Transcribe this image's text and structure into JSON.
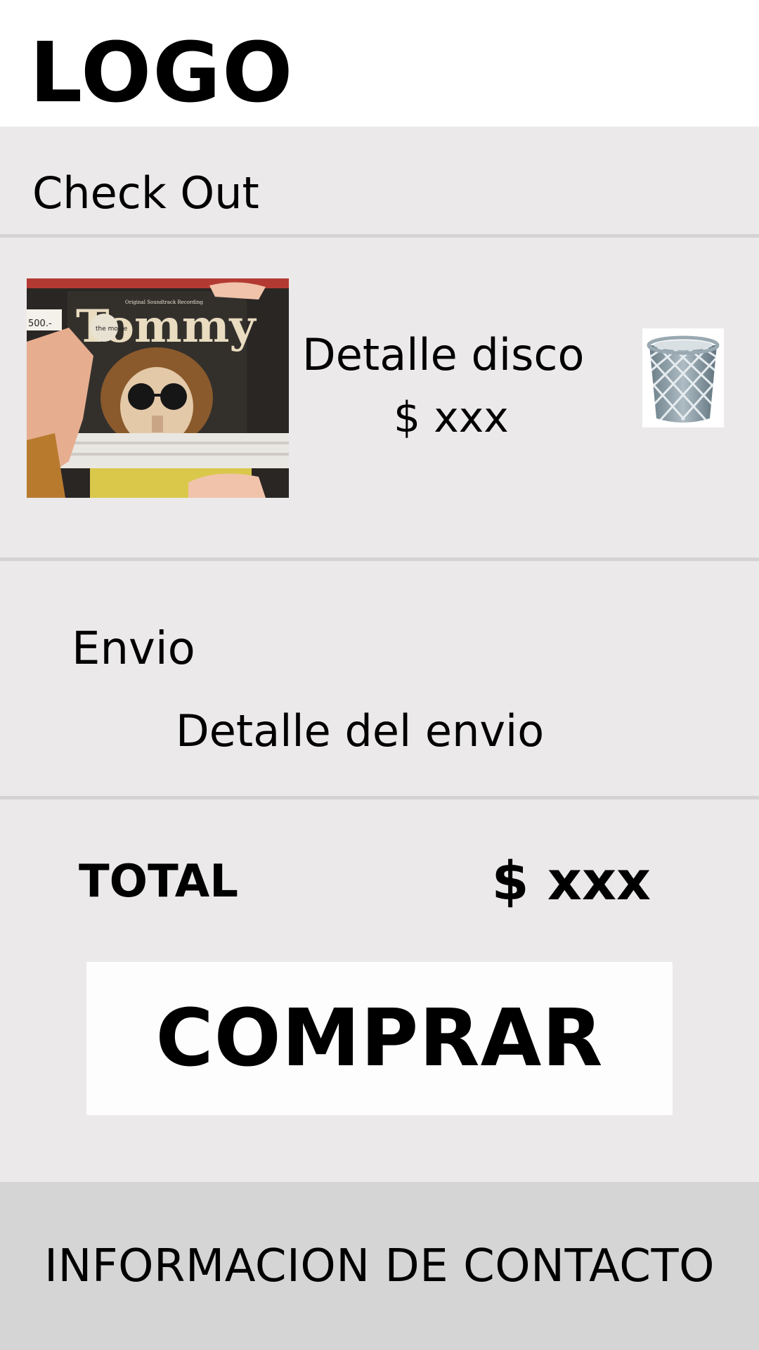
{
  "header": {
    "logo_text": "LOGO"
  },
  "checkout": {
    "title": "Check Out"
  },
  "cart_item": {
    "name": "Detalle disco",
    "price": "$ xxx",
    "album_title": "Tommy",
    "album_subtitle": "Original Soundtrack Recording",
    "album_badge": "the movie",
    "sticker_price": "500.-",
    "delete_icon": "trash-icon"
  },
  "shipping": {
    "label": "Envio",
    "detail": "Detalle del envio"
  },
  "total": {
    "label": "TOTAL",
    "value": "$ xxx"
  },
  "buy_button": {
    "label": "COMPRAR"
  },
  "footer": {
    "contact_label": "INFORMACION DE CONTACTO"
  },
  "colors": {
    "background": "#ebe9ea",
    "header": "#ffffff",
    "footer": "#d6d5d6",
    "button": "#fdfdfd",
    "divider": "#d4d3d4"
  }
}
